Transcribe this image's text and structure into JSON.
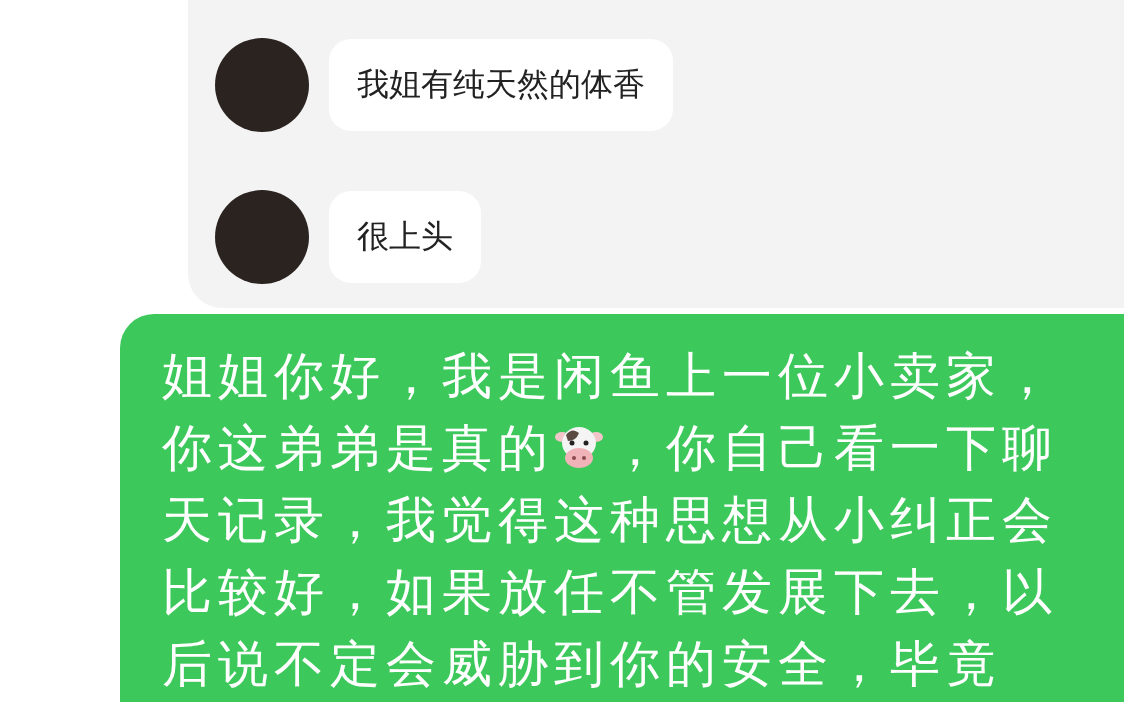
{
  "received_messages": [
    {
      "text": "我姐有纯天然的体香"
    },
    {
      "text": "很上头"
    }
  ],
  "sent_message": {
    "text_before_emoji": "姐姐你好，我是闲鱼上一位小卖家，你这弟弟是真的",
    "text_after_emoji": "，你自己看一下聊天记录，我觉得这种思想从小纠正会比较好，如果放任不管发展下去，以后说不定会威胁到你的安全，毕竟"
  }
}
